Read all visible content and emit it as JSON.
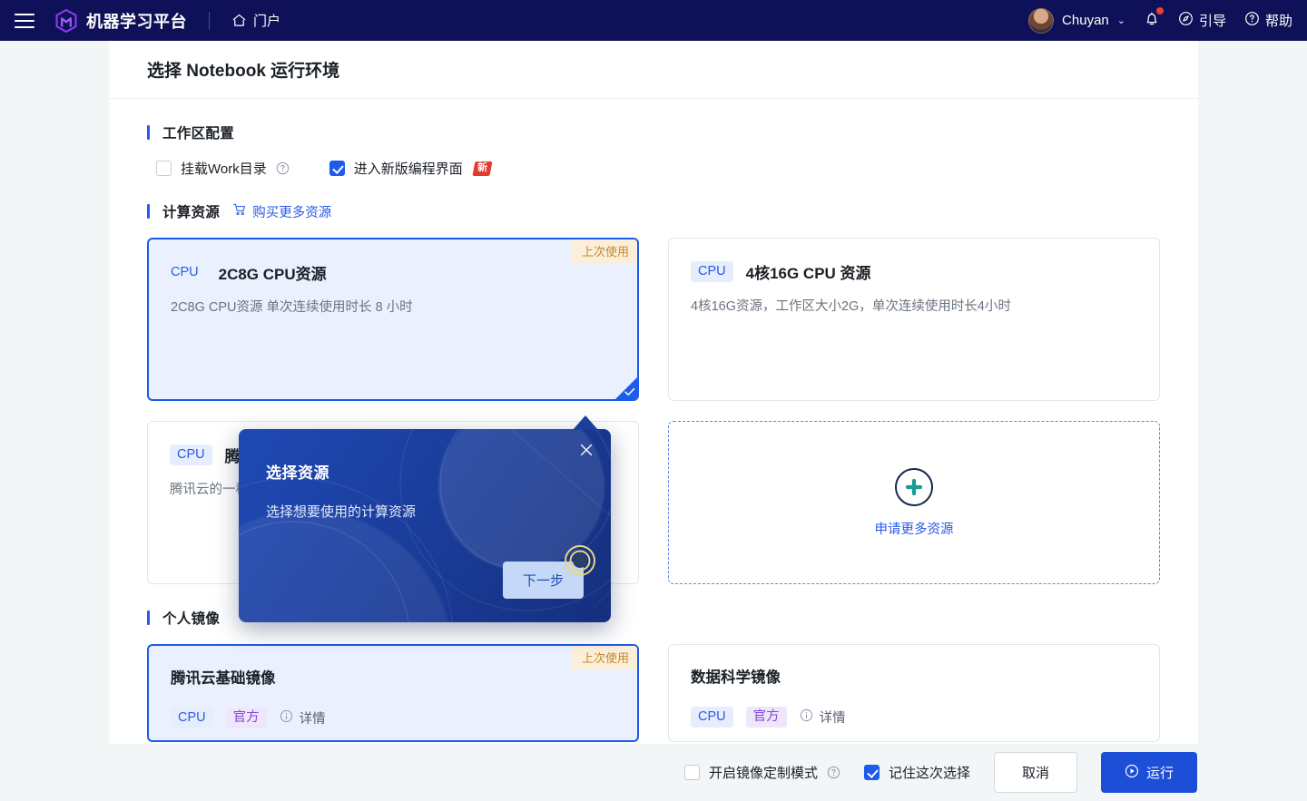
{
  "nav": {
    "menu_icon": "hamburger-icon",
    "logo_icon": "platform-logo-icon",
    "brand": "机器学习平台",
    "portal_icon": "home-icon",
    "portal": "门户",
    "user_name": "Chuyan",
    "user_caret": "⌄",
    "bell_icon": "bell-icon",
    "guide_icon": "compass-icon",
    "guide": "引导",
    "help_icon": "question-circle-icon",
    "help": "帮助"
  },
  "modal": {
    "title": "选择 Notebook 运行环境",
    "workspace": {
      "section_title": "工作区配置",
      "mount_work_label": "挂载Work目录",
      "mount_work_checked": false,
      "mount_help_icon": "question-circle-icon",
      "new_ide_label": "进入新版编程界面",
      "new_ide_checked": true,
      "new_badge": "新"
    },
    "compute": {
      "section_title": "计算资源",
      "buy_icon": "cart-icon",
      "buy_label": "购买更多资源",
      "last_used_badge": "上次使用",
      "cards": [
        {
          "tag": "CPU",
          "name": "2C8G CPU资源",
          "desc": "2C8G CPU资源 单次连续使用时长 8 小时",
          "selected": true,
          "last_used": true
        },
        {
          "tag": "CPU",
          "name": "4核16G CPU 资源",
          "desc": "4核16G资源，工作区大小2G，单次连续使用时长4小时",
          "selected": false,
          "last_used": false
        },
        {
          "tag": "CPU",
          "name": "腾讯云资源",
          "desc": "腾讯云的一种计算资源",
          "selected": false,
          "last_used": false
        }
      ],
      "apply_more": {
        "plus_icon": "plus-circle-icon",
        "label": "申请更多资源"
      }
    },
    "images": {
      "section_title": "个人镜像",
      "last_used_badge": "上次使用",
      "detail_icon": "info-circle-icon",
      "detail_label": "详情",
      "cards": [
        {
          "name": "腾讯云基础镜像",
          "tag_cpu": "CPU",
          "tag_official": "官方",
          "selected": true,
          "last_used": true
        },
        {
          "name": "数据科学镜像",
          "tag_cpu": "CPU",
          "tag_official": "官方",
          "selected": false,
          "last_used": false
        }
      ]
    }
  },
  "popover": {
    "title": "选择资源",
    "text": "选择想要使用的计算资源",
    "next_label": "下一步",
    "close_icon": "close-icon"
  },
  "footer": {
    "custom_mode_label": "开启镜像定制模式",
    "custom_mode_checked": false,
    "custom_help_icon": "question-circle-icon",
    "remember_label": "记住这次选择",
    "remember_checked": true,
    "cancel_label": "取消",
    "run_icon": "play-circle-icon",
    "run_label": "运行"
  },
  "colors": {
    "nav_bg": "#0e1157",
    "accent_blue": "#1d5bea",
    "run_blue": "#1d4ed8",
    "page_bg": "#f2f6f7",
    "last_used_bg": "#fcefd9",
    "last_used_fg": "#c4872c",
    "official_purple": "#7b49d6",
    "new_red": "#e23b2e",
    "popover_blue": "#1c3f9f"
  }
}
